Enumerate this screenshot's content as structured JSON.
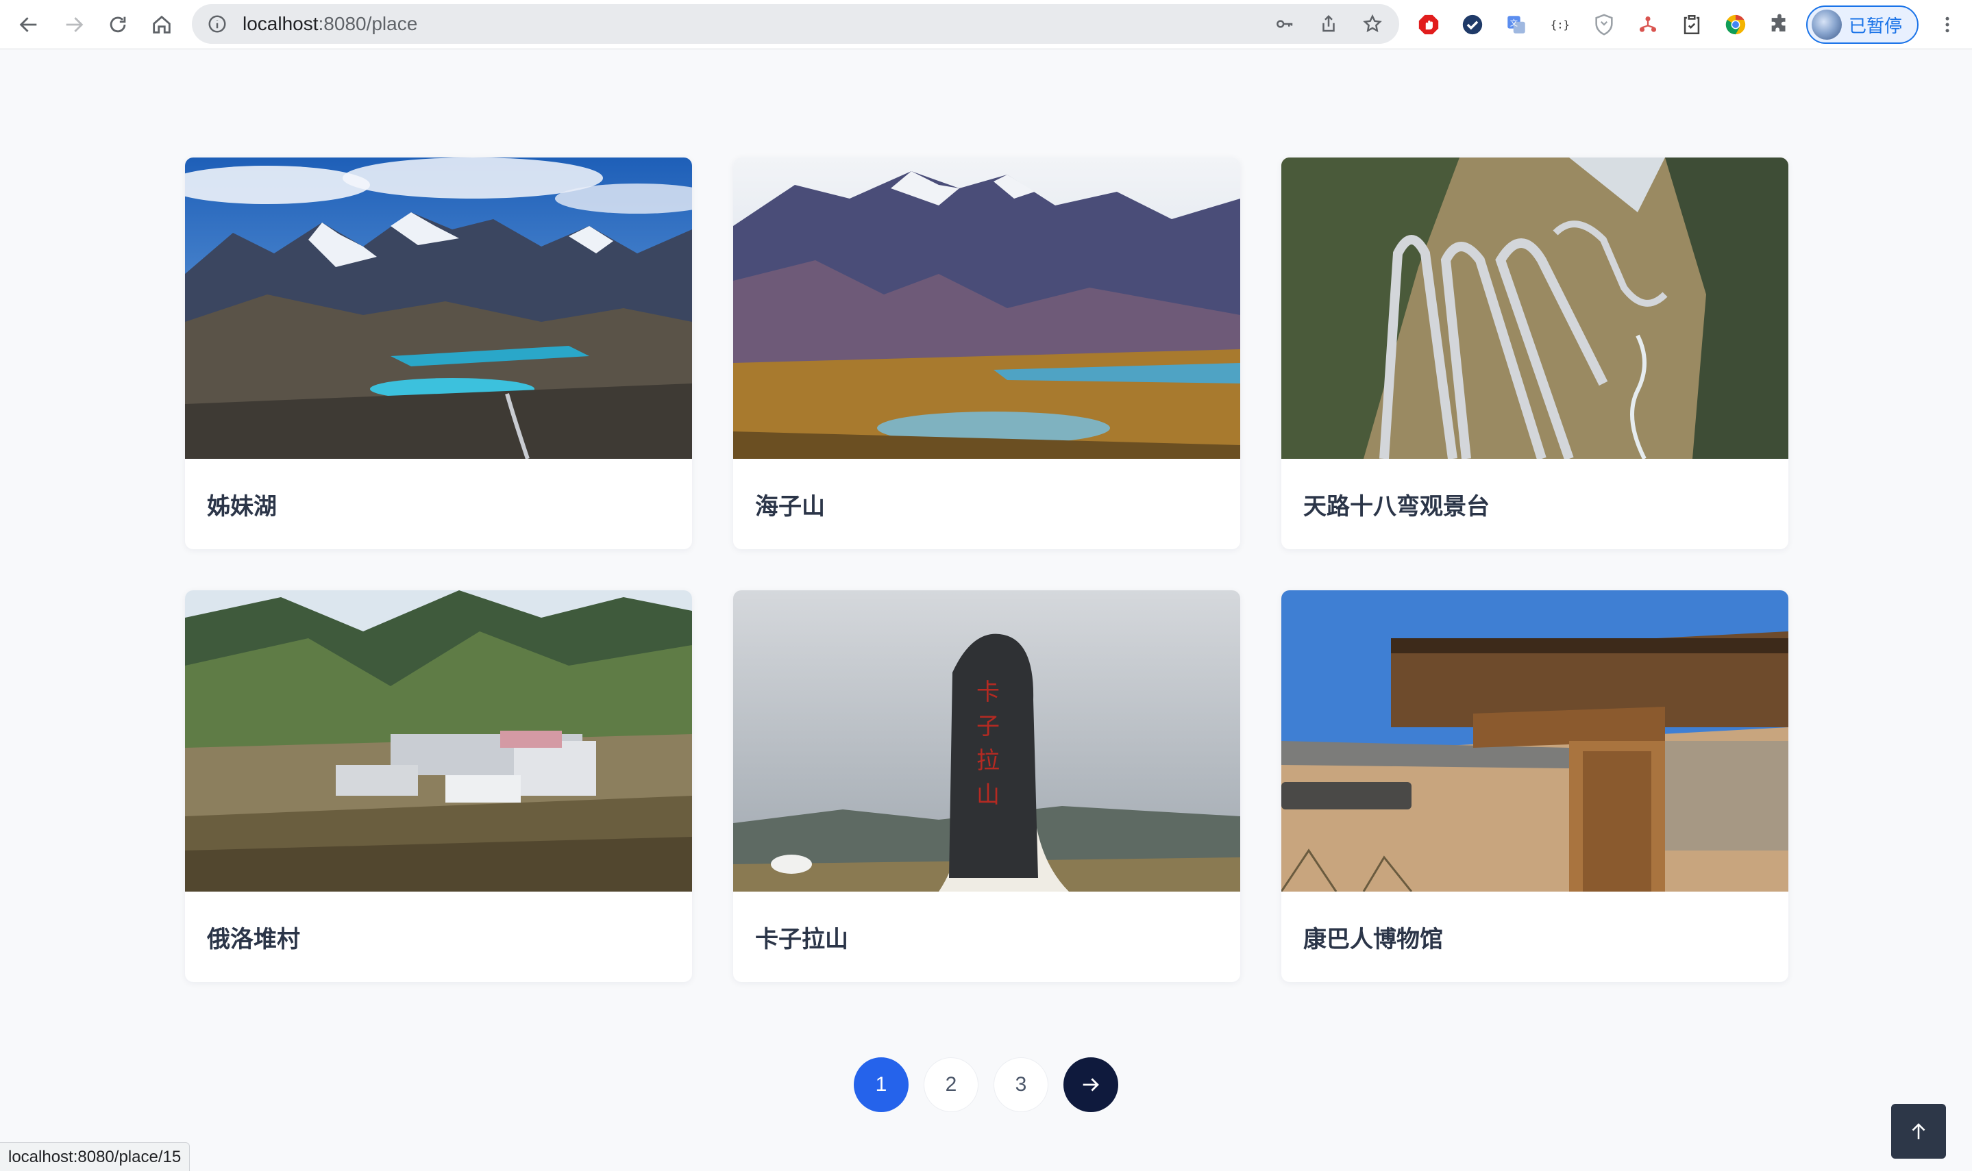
{
  "browser": {
    "url_host": "localhost",
    "url_rest": ":8080/place",
    "profile_label": "已暂停",
    "status_url": "localhost:8080/place/15"
  },
  "places": [
    {
      "name": "姊妹湖",
      "scene": "lakes"
    },
    {
      "name": "海子山",
      "scene": "lakes2"
    },
    {
      "name": "天路十八弯观景台",
      "scene": "road"
    },
    {
      "name": "俄洛堆村",
      "scene": "village"
    },
    {
      "name": "卡子拉山",
      "scene": "stone"
    },
    {
      "name": "康巴人博物馆",
      "scene": "museum"
    }
  ],
  "pagination": {
    "pages": [
      "1",
      "2",
      "3"
    ],
    "active": "1",
    "next_icon": "arrow-right-icon"
  },
  "colors": {
    "accent": "#2563eb",
    "dark": "#0f1a3d"
  }
}
